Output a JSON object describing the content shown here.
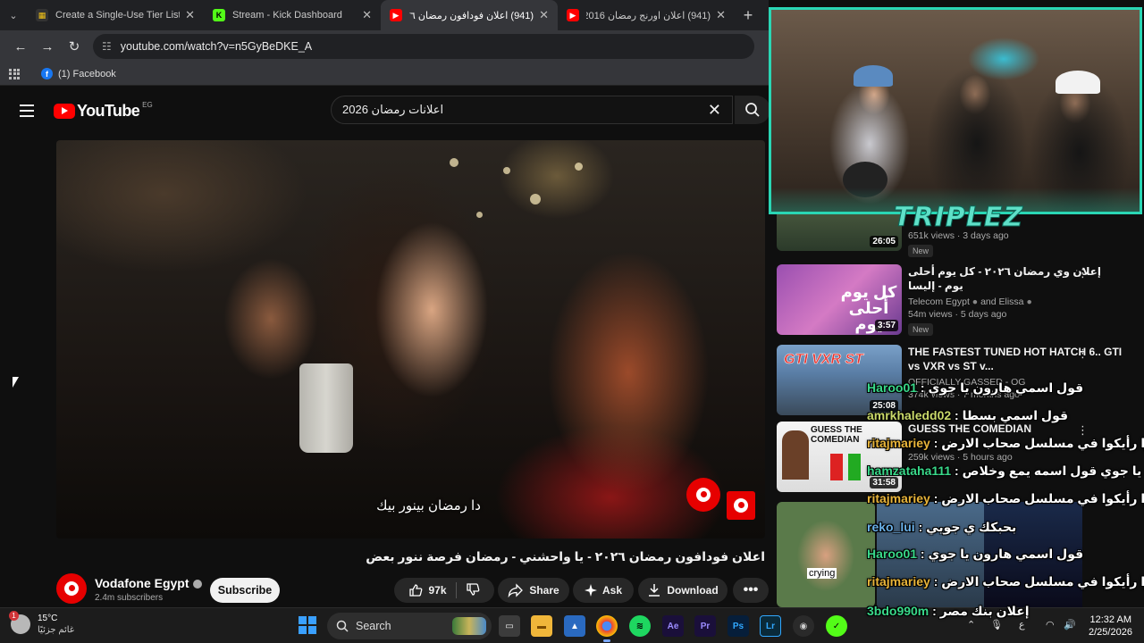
{
  "browser": {
    "tabs": [
      {
        "label": "Create a Single-Use Tier List (R",
        "favicon": "tiermaker-icon"
      },
      {
        "label": "Stream - Kick Dashboard",
        "favicon": "kick-icon"
      },
      {
        "label": "(941) اعلان فودافون رمضان ٢٠٢٦ -",
        "favicon": "youtube-icon",
        "active": true
      },
      {
        "label": "(941) اعلان اورنج رمضان 2016 -",
        "favicon": "youtube-icon"
      }
    ],
    "url": "youtube.com/watch?v=n5GyBeDKE_A",
    "bookmark": "(1) Facebook"
  },
  "youtube": {
    "logo_text": "YouTube",
    "region": "EG",
    "search_value": "اعلانات رمضان 2026",
    "video": {
      "subtitle": "دا رمضان بينور بيك",
      "title": "اعلان فودافون رمضان ٢٠٢٦ - يا واحشني - رمضان فرصة ننور بعض"
    },
    "channel": {
      "name": "Vodafone Egypt",
      "subscribers": "2.4m subscribers"
    },
    "actions": {
      "subscribe": "Subscribe",
      "likes": "97k",
      "share": "Share",
      "ask": "Ask",
      "download": "Download"
    }
  },
  "sidebar_videos": [
    {
      "title": "",
      "channel": "",
      "views": "651k views · 3 days ago",
      "badge": "New",
      "duration": "26:05"
    },
    {
      "title": "إعلان وي رمضان ٢٠٢٦ - كل يوم أحلى يوم - إليسا",
      "channel": "Telecom Egypt",
      "channel2": "and Elissa",
      "views": "54m views · 5 days ago",
      "badge": "New",
      "duration": "3:57",
      "thumb_text": "كل يوم أحلى يوم"
    },
    {
      "title": "THE FASTEST TUNED HOT HATCH 6.. GTI vs VXR vs ST v...",
      "channel": "OFFICIALLY GASSED - OG",
      "views": "374k views · 7 months ago",
      "duration": "25:08",
      "thumb_text": "GTI VXR ST"
    },
    {
      "title": "GUESS THE COMEDIAN",
      "channel": "",
      "views": "259k views · 5 hours ago",
      "duration": "31:58",
      "thumb_text": "GUESS THE COMEDIAN"
    },
    {
      "title": "",
      "channel": "",
      "views": "",
      "duration": "",
      "thumb_text": "crying"
    }
  ],
  "stream_overlay": {
    "brand": "TRIPLEZ",
    "chat": [
      {
        "user": "Haroo01",
        "sep": " : ",
        "msg": "قول اسمي هارون يا جوي"
      },
      {
        "user": "amrkhaledd02",
        "sep": " : ",
        "msg": "قول اسمي بسطا"
      },
      {
        "user": "ritajmariey",
        "sep": " : ",
        "msg": "قولوا رأيكوا في مسلسل صحاب الارض"
      },
      {
        "user": "hamzataha111",
        "sep": " : ",
        "msg": "يا جوي قول اسمه يمع وخلاص"
      },
      {
        "user": "ritajmariey",
        "sep": " : ",
        "msg": "قولوا رأيكوا في مسلسل صحاب الارض"
      },
      {
        "user": "reko_lui",
        "sep": " : ",
        "msg": "بحبكك ي جويي"
      },
      {
        "user": "Haroo01",
        "sep": " : ",
        "msg": "قول اسمي هارون يا جوي"
      },
      {
        "user": "ritajmariey",
        "sep": " : ",
        "msg": "قولوا رأيكوا في مسلسل صحاب الارض"
      },
      {
        "user": "3bdo990m",
        "sep": " : ",
        "msg": "إعلان بنك مصر"
      }
    ]
  },
  "taskbar": {
    "weather_temp": "15°C",
    "weather_desc": "غائم جزئيًا",
    "weather_badge": "1",
    "search_label": "Search",
    "lang": "ع",
    "time": "12:32 AM",
    "date": "2/25/2026"
  }
}
